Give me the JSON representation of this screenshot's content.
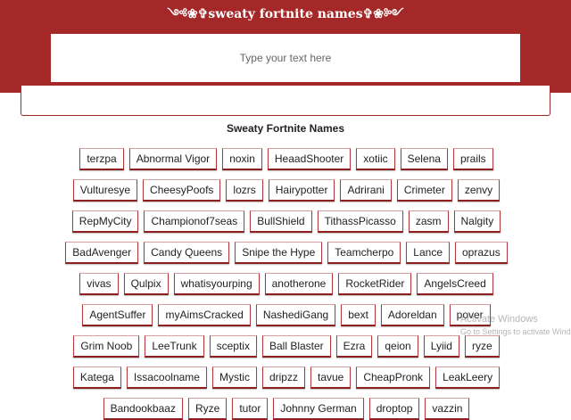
{
  "header": {
    "title": "༺❀✞sweaty fortnite names✞❀༻",
    "accent_color": "#a42828"
  },
  "input": {
    "placeholder": "Type your text here",
    "value": ""
  },
  "section": {
    "title": "Sweaty Fortnite Names"
  },
  "names": [
    "terzpa",
    "Abnormal Vigor",
    "noxin",
    "HeaadShooter",
    "xotiic",
    "Selena",
    "prails",
    "Vulturesye",
    "CheesyPoofs",
    "lozrs",
    "Hairypotter",
    "Adrirani",
    "Crimeter",
    "zenvy",
    "RepMyCity",
    "Championof7seas",
    "BullShield",
    "TithassPicasso",
    "zasm",
    "Nalgity",
    "BadAvenger",
    "Candy Queens",
    "Snipe the Hype",
    "Teamcherpo",
    "Lance",
    "oprazus",
    "vivas",
    "Qulpix",
    "whatisyourping",
    "anotherone",
    "RocketRider",
    "AngelsCreed",
    "AgentSuffer",
    "myAimsCracked",
    "NashediGang",
    "bext",
    "Adoreldan",
    "pover",
    "Grim Noob",
    "LeeTrunk",
    "sceptix",
    "Ball Blaster",
    "Ezra",
    "qeion",
    "Lyiid",
    "ryze",
    "Katega",
    "Issacoolname",
    "Mystic",
    "dripzz",
    "tavue",
    "CheapPronk",
    "LeakLeery",
    "Bandookbaaz",
    "Ryze",
    "tutor",
    "Johnny German",
    "droptop",
    "vazzin"
  ],
  "watermark": {
    "line1": "Activate Windows",
    "line2": "Go to Settings to activate Windows."
  }
}
